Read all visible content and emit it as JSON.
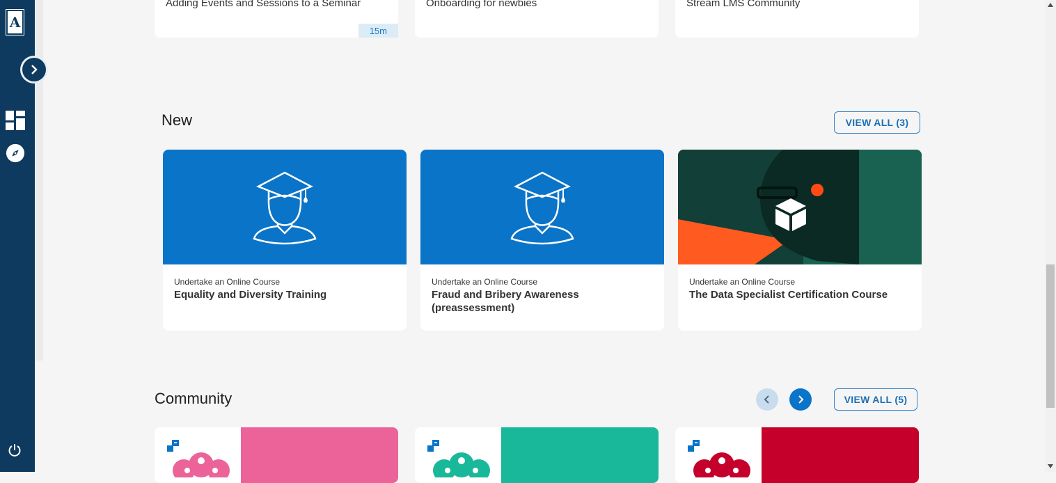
{
  "sidebar": {
    "logo_letter": "A",
    "icons": [
      "chevron-right-icon",
      "dashboard-icon",
      "compass-icon",
      "power-icon"
    ]
  },
  "top_cards": [
    {
      "title": "Adding Events and Sessions to a Seminar",
      "duration": "15m"
    },
    {
      "title": "Onboarding for newbies"
    },
    {
      "title": "Stream LMS Community"
    }
  ],
  "new_section": {
    "title": "New",
    "view_all": "VIEW ALL  (3)",
    "cards": [
      {
        "type": "Undertake an Online Course",
        "title": "Equality and Diversity Training",
        "image": "graduate-icon"
      },
      {
        "type": "Undertake an Online Course",
        "title": "Fraud and Bribery Awareness (preassessment)",
        "image": "graduate-icon"
      },
      {
        "type": "Undertake an Online Course",
        "title": "The Data Specialist Certification Course",
        "image": "photo"
      }
    ]
  },
  "community_section": {
    "title": "Community",
    "view_all": "VIEW ALL (5)",
    "cards": [
      {
        "accent": "#ec6399"
      },
      {
        "accent": "#1ab89a"
      },
      {
        "accent": "#c4002b"
      }
    ]
  },
  "colors": {
    "sidebar": "#0d3a5e",
    "primary": "#0a74c9",
    "background": "#f5f5f5"
  }
}
